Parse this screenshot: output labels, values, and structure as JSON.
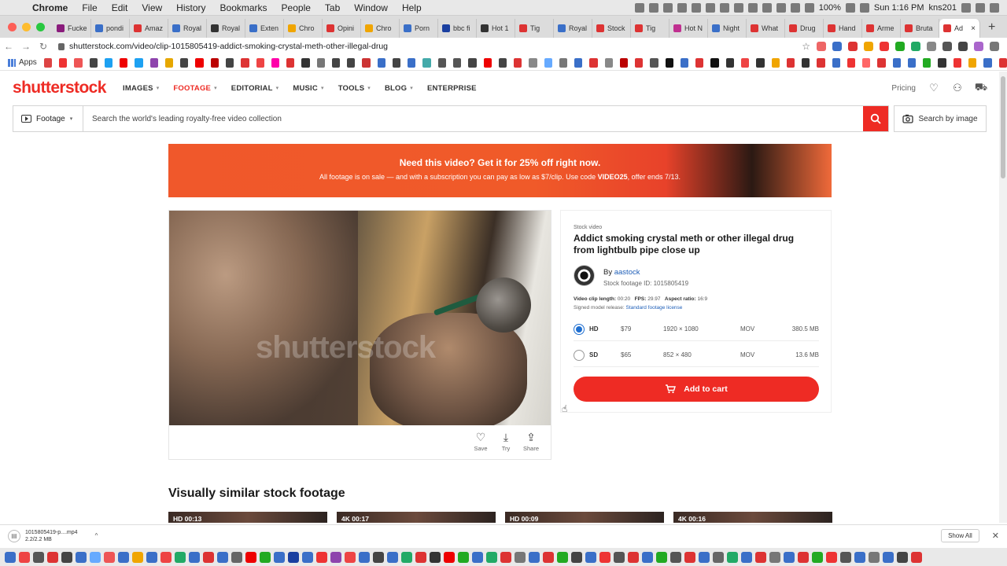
{
  "menubar": {
    "app": "Chrome",
    "items": [
      "File",
      "Edit",
      "View",
      "History",
      "Bookmarks",
      "People",
      "Tab",
      "Window",
      "Help"
    ],
    "battery": "100%",
    "clock": "Sun 1:16 PM",
    "user": "kns201"
  },
  "tabs": [
    "Fucke",
    "pondi",
    "Amaz",
    "Royal",
    "Royal",
    "Exten",
    "Chro",
    "Opini",
    "Chro",
    "Porn",
    "bbc fi",
    "Hot 1",
    "Tig",
    "Royal",
    "Stock",
    "Tig",
    "Hot N",
    "Night",
    "What",
    "Drug",
    "Hand",
    "Arme",
    "Bruta",
    "Ad"
  ],
  "tab_colors": [
    "#8a1c7c",
    "#3a6fc8",
    "#d33",
    "#3a6fc8",
    "#333",
    "#3a6fc8",
    "#f0a500",
    "#d33",
    "#f0a500",
    "#3a6fc8",
    "#1a3fa0",
    "#333",
    "#d33",
    "#3a6fc8",
    "#d33",
    "#d33",
    "#c03090",
    "#3a6fc8",
    "#d33",
    "#d33",
    "#d33",
    "#d33",
    "#d33",
    "#d33"
  ],
  "address": {
    "url": "shutterstock.com/video/clip-1015805419-addict-smoking-crystal-meth-other-illegal-drug"
  },
  "bookmarks": {
    "apps_label": "Apps",
    "colors": [
      "#d44",
      "#e33",
      "#e55",
      "#444",
      "#1da1f2",
      "#e00",
      "#1da1f2",
      "#8e44ad",
      "#e6a700",
      "#444",
      "#e00",
      "#b00",
      "#444",
      "#d33",
      "#e44",
      "#f0a",
      "#d33",
      "#333",
      "#777",
      "#444",
      "#444",
      "#c33",
      "#3a6fc8",
      "#444",
      "#3a6fc8",
      "#4aa",
      "#555",
      "#555",
      "#444",
      "#e00",
      "#444",
      "#d33",
      "#888",
      "#6af",
      "#777",
      "#3a6fc8",
      "#d33",
      "#888",
      "#b00",
      "#d33",
      "#555",
      "#111",
      "#3a6fc8",
      "#d33",
      "#111",
      "#333",
      "#e44",
      "#333",
      "#f0a500",
      "#d33",
      "#333",
      "#d33",
      "#3a6fc8",
      "#e33",
      "#f66",
      "#d33",
      "#3a6fc8",
      "#3a6fc8",
      "#2a2",
      "#333",
      "#e33",
      "#f0a500",
      "#3a6fc8",
      "#d33"
    ]
  },
  "header": {
    "logo": "shutterstock",
    "nav": [
      {
        "label": "IMAGES",
        "active": false
      },
      {
        "label": "FOOTAGE",
        "active": true
      },
      {
        "label": "EDITORIAL",
        "active": false
      },
      {
        "label": "MUSIC",
        "active": false
      },
      {
        "label": "TOOLS",
        "active": false
      },
      {
        "label": "BLOG",
        "active": false
      },
      {
        "label": "ENTERPRISE",
        "active": false
      }
    ],
    "pricing": "Pricing"
  },
  "search": {
    "type": "Footage",
    "placeholder": "Search the world's leading royalty-free video collection",
    "image_search": "Search by image"
  },
  "banner": {
    "headline": "Need this video? Get it for 25% off right now.",
    "sub_pre": "All footage is on sale — and with a subscription you can pay as low as $7/clip. Use code ",
    "code": "VIDEO25",
    "sub_post": ", offer ends 7/13."
  },
  "player": {
    "watermark": "shutterstock"
  },
  "actions": [
    {
      "label": "Save",
      "icon": "heart-icon",
      "glyph": "♡"
    },
    {
      "label": "Try",
      "icon": "download-icon",
      "glyph": "⤓"
    },
    {
      "label": "Share",
      "icon": "share-icon",
      "glyph": "⇪"
    }
  ],
  "clip": {
    "kicker": "Stock video",
    "title": "Addict smoking crystal meth or other illegal drug from lightbulb pipe close up",
    "by_label": "By",
    "author": "aastock",
    "stock_id": "Stock footage ID: 1015805419",
    "length_label": "Video clip length:",
    "length": "00:20",
    "fps_label": "FPS:",
    "fps": "29.97",
    "aspect_label": "Aspect ratio:",
    "aspect": "16:9",
    "release_label": "Signed model release:",
    "license": "Standard footage license",
    "options": [
      {
        "quality": "HD",
        "price": "$79",
        "resolution": "1920 × 1080",
        "format": "MOV",
        "size": "380.5 MB",
        "selected": true
      },
      {
        "quality": "SD",
        "price": "$65",
        "resolution": "852 × 480",
        "format": "MOV",
        "size": "13.6 MB",
        "selected": false
      }
    ],
    "cart_label": "Add to cart"
  },
  "similar": {
    "heading": "Visually similar stock footage",
    "thumbs": [
      "HD 00:13",
      "4K 00:17",
      "HD 00:09",
      "4K 00:16"
    ]
  },
  "downloads": {
    "file_name": "1015805419-p....mp4",
    "file_size": "2.2/2.2 MB",
    "show_all": "Show All"
  },
  "dock": {
    "colors": [
      "#3a6fc8",
      "#e44",
      "#555",
      "#d33",
      "#444",
      "#3a6fc8",
      "#6af",
      "#e55",
      "#3a6fc8",
      "#f0a500",
      "#3a6fc8",
      "#e44",
      "#2a6",
      "#3a6fc8",
      "#d33",
      "#3a6fc8",
      "#666",
      "#e00",
      "#2a2",
      "#3a6fc8",
      "#1a3fa0",
      "#3a6fc8",
      "#e33",
      "#8e44ad",
      "#e44",
      "#3a6fc8",
      "#444",
      "#3a6fc8",
      "#2a6",
      "#d33",
      "#333",
      "#e00",
      "#2a2",
      "#3a6fc8",
      "#2a6",
      "#d33",
      "#777",
      "#3a6fc8",
      "#d33",
      "#2a2",
      "#444",
      "#3a6fc8",
      "#e33",
      "#555",
      "#d33",
      "#3a6fc8",
      "#2a2",
      "#555",
      "#d33",
      "#3a6fc8",
      "#666",
      "#2a6",
      "#3a6fc8",
      "#d33",
      "#777",
      "#3a6fc8",
      "#d33",
      "#2a2",
      "#e33",
      "#555",
      "#3a6fc8",
      "#777",
      "#3a6fc8",
      "#444",
      "#d33"
    ]
  }
}
